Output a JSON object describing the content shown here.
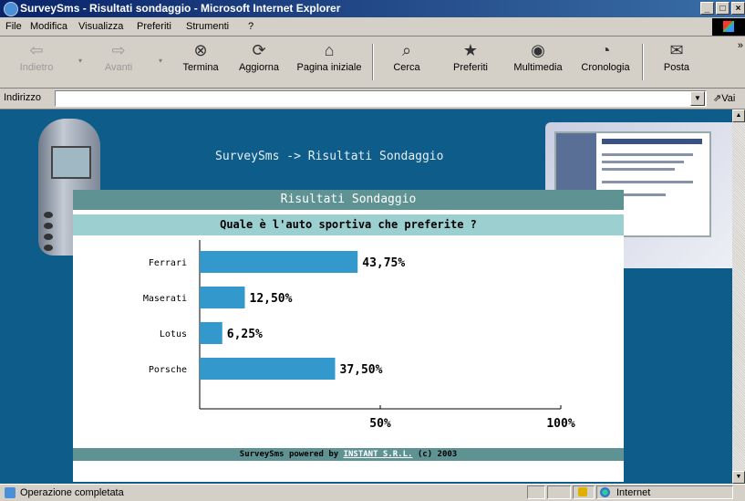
{
  "window": {
    "title": "SurveySms - Risultati sondaggio - Microsoft Internet Explorer",
    "buttons": [
      "_",
      "□",
      "×"
    ]
  },
  "menu": [
    "File",
    "Modifica",
    "Visualizza",
    "Preferiti",
    "Strumenti",
    "?"
  ],
  "toolbar": [
    {
      "label": "Indietro",
      "icon": "back-arrow-icon",
      "enabled": false
    },
    {
      "label": "Avanti",
      "icon": "forward-arrow-icon",
      "enabled": false
    },
    {
      "label": "Termina",
      "icon": "stop-icon",
      "enabled": true
    },
    {
      "label": "Aggiorna",
      "icon": "refresh-icon",
      "enabled": true
    },
    {
      "label": "Pagina iniziale",
      "icon": "home-icon",
      "enabled": true
    },
    {
      "label": "Cerca",
      "icon": "search-icon",
      "enabled": true
    },
    {
      "label": "Preferiti",
      "icon": "favorites-icon",
      "enabled": true
    },
    {
      "label": "Multimedia",
      "icon": "media-icon",
      "enabled": true
    },
    {
      "label": "Cronologia",
      "icon": "history-icon",
      "enabled": true
    },
    {
      "label": "Posta",
      "icon": "mail-icon",
      "enabled": true
    }
  ],
  "address": {
    "label": "Indirizzo",
    "value": "",
    "go_label": "Vai"
  },
  "page": {
    "heading": "SurveySms -> Risultati Sondaggio",
    "panel_title": "Risultati Sondaggio",
    "question": "Quale è l'auto sportiva che preferite ?",
    "footer_prefix": "SurveySms powered by ",
    "footer_link": "INSTANT S.R.L.",
    "footer_suffix": " (c) 2003"
  },
  "chart_data": {
    "type": "bar",
    "orientation": "horizontal",
    "categories": [
      "Ferrari",
      "Maserati",
      "Lotus",
      "Porsche"
    ],
    "values": [
      43.75,
      12.5,
      6.25,
      37.5
    ],
    "value_labels": [
      "43,75%",
      "12,50%",
      "6,25%",
      "37,50%"
    ],
    "xlim": [
      0,
      100
    ],
    "ticks": [
      50,
      100
    ],
    "tick_labels": [
      "50%",
      "100%"
    ],
    "bar_color": "#3399cc"
  },
  "status": {
    "text": "Operazione completata",
    "zone": "Internet"
  },
  "colors": {
    "page_bg": "#0e5c8a",
    "panel_header": "#5f9292",
    "question_bg": "#9ccfd0"
  }
}
